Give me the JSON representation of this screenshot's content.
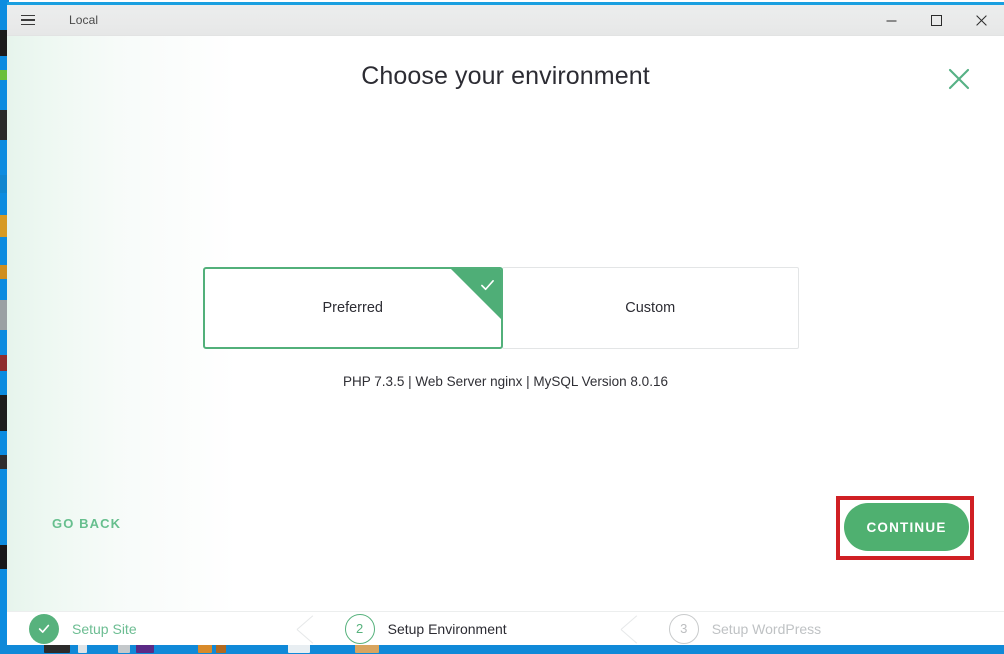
{
  "window": {
    "title": "Local",
    "menu_icon": "hamburger-icon",
    "controls": {
      "minimize": "minimize-icon",
      "maximize": "maximize-icon",
      "close": "close-icon"
    }
  },
  "modal": {
    "title": "Choose your environment",
    "close_icon": "close-icon"
  },
  "environment": {
    "options": [
      {
        "label": "Preferred",
        "selected": true
      },
      {
        "label": "Custom",
        "selected": false
      }
    ],
    "details": "PHP 7.3.5 | Web Server nginx | MySQL Version 8.0.16",
    "php_version": "7.3.5",
    "web_server": "nginx",
    "mysql_version": "8.0.16",
    "check_icon": "check-icon"
  },
  "actions": {
    "back_label": "GO BACK",
    "continue_label": "CONTINUE",
    "highlight_color": "#d01f24"
  },
  "steps": [
    {
      "marker": "✓",
      "label": "Setup Site",
      "state": "done"
    },
    {
      "marker": "2",
      "label": "Setup Environment",
      "state": "active"
    },
    {
      "marker": "3",
      "label": "Setup WordPress",
      "state": "todo"
    }
  ],
  "colors": {
    "brand_green": "#4fb070",
    "green_light": "#67bf8e",
    "green_border": "#52b07a",
    "text_dark": "#2c2c33",
    "text_muted": "#bfc2c4",
    "accent_blue": "#1a9fe0",
    "annotation_red": "#d01f24"
  }
}
